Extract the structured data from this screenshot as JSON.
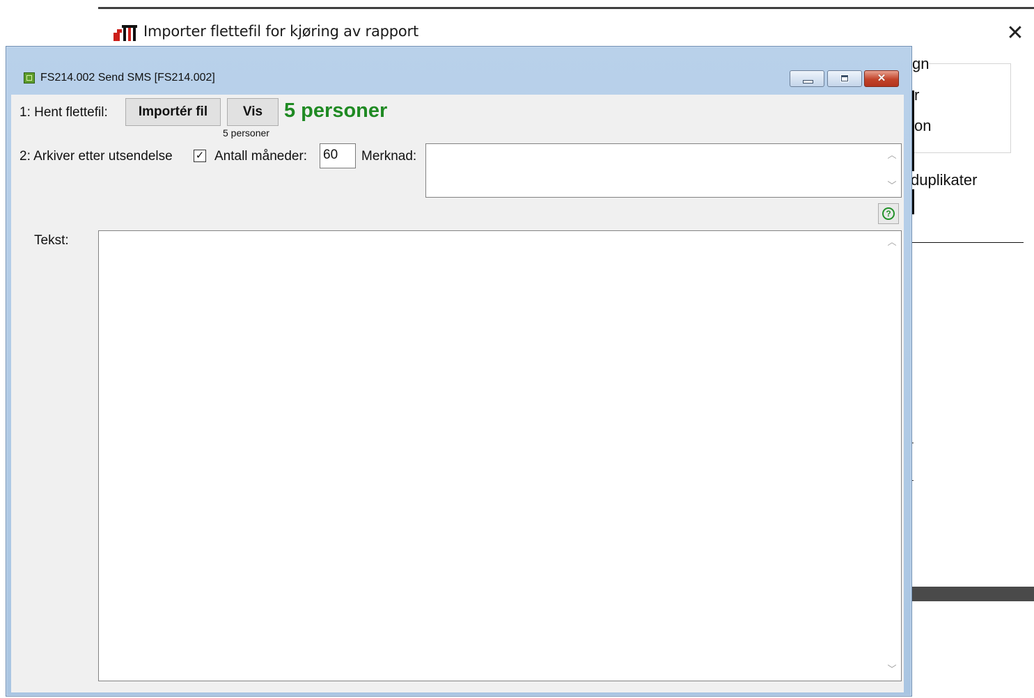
{
  "background_window": {
    "title": "Importer flettefil for kjøring av rapport",
    "close_glyph": "✕",
    "partial_texts": {
      "group_label": "gn",
      "item_r": "r",
      "item_on": "on",
      "item_duplikater": "duplikater"
    }
  },
  "window": {
    "title": "FS214.002 Send SMS  [FS214.002]",
    "controls": {
      "minimize": "minimize",
      "maximize": "maximize",
      "close": "✕"
    }
  },
  "step1": {
    "label": "1: Hent flettefil:",
    "import_button": "Importér fil",
    "show_button": "Vis",
    "count_large": "5 personer",
    "count_small": "5 personer",
    "count_color": "#1f8a23"
  },
  "step2": {
    "label": "2: Arkiver etter utsendelse",
    "archive_checked": true,
    "checkbox_glyph": "✓",
    "months_label": "Antall måneder:",
    "months_value": "60",
    "note_label": "Merknad:",
    "note_value": ""
  },
  "help": {
    "icon": "?"
  },
  "text_section": {
    "label": "Tekst:",
    "value": ""
  },
  "scroll_glyphs": {
    "up": "︿",
    "down": "﹀"
  },
  "colors": {
    "accent_green": "#1f8a23",
    "window_frame": "#b9d1ea",
    "client_bg": "#f0f0f0",
    "close_red": "#c2432a"
  }
}
